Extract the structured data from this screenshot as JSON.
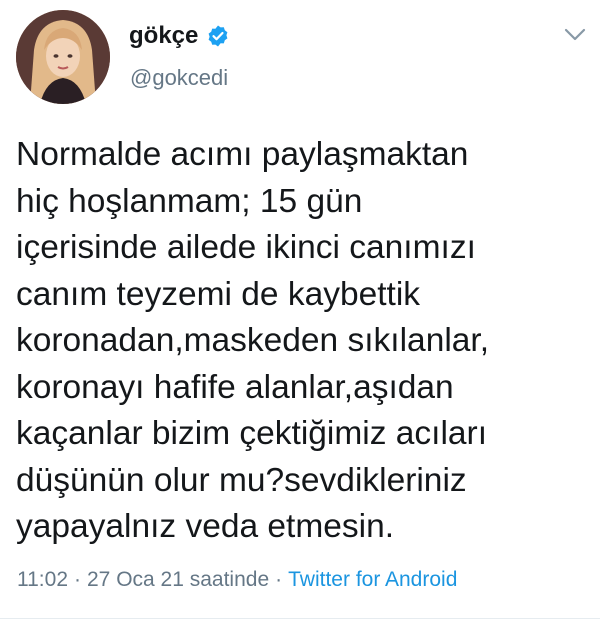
{
  "tweet": {
    "display_name": "gökçe",
    "handle": "@gokcedi",
    "verified": true,
    "text_lines": [
      "Normalde acımı paylaşmaktan",
      "hiç hoşlanmam; 15 gün",
      "içerisinde ailede ikinci canımızı",
      "canım teyzemi de kaybettik",
      "koronadan,maskeden sıkılanlar,",
      "koronayı hafife alanlar,aşıdan",
      "kaçanlar bizim çektiğimiz acıları",
      "düşünün olur mu?sevdikleriniz",
      "yapayalnız veda etmesin."
    ],
    "time": "11:02",
    "separator": "·",
    "date": "27 Oca 21 saatinde",
    "source": "Twitter for Android"
  },
  "icons": {
    "verified": "verified-badge-icon",
    "caret": "chevron-down-icon"
  },
  "colors": {
    "text": "#14171a",
    "secondary": "#657786",
    "link": "#1b95e0",
    "verified": "#1da1f2"
  }
}
